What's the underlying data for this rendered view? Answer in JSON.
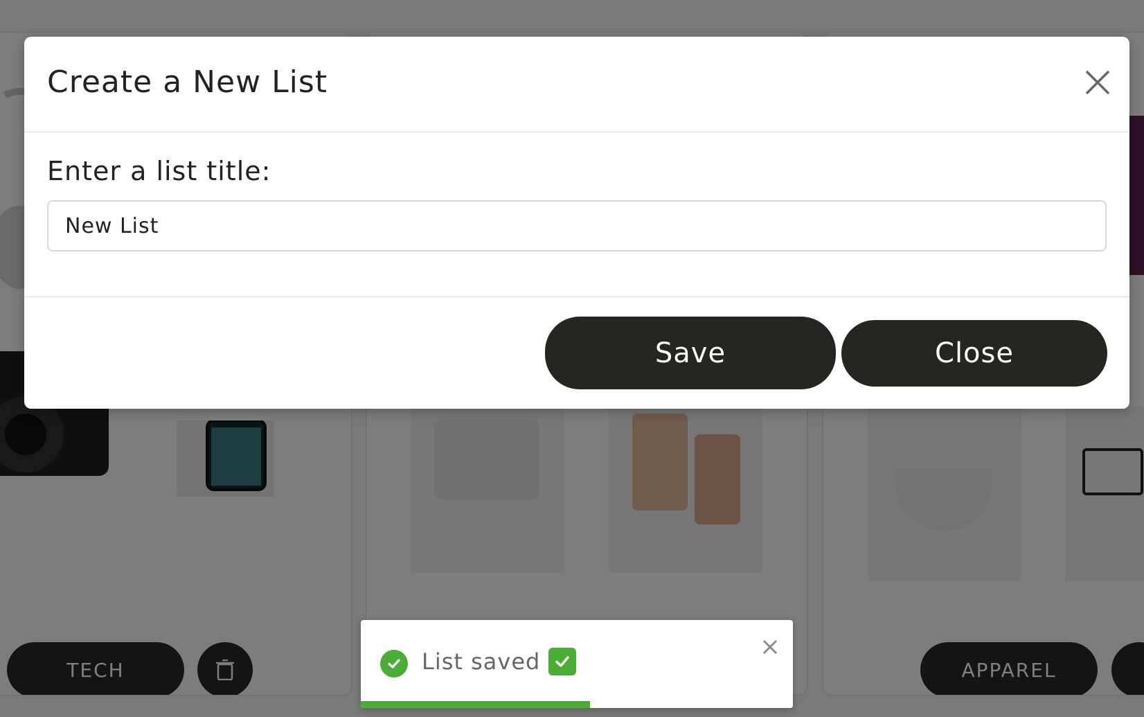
{
  "background": {
    "cards": [
      {
        "pill_label": "TECH"
      },
      {
        "pill_label": ""
      },
      {
        "pill_label": "APPAREL"
      }
    ]
  },
  "modal": {
    "title": "Create a New List",
    "field_label": "Enter a list title:",
    "input_value": "New List",
    "save_label": "Save",
    "close_label": "Close"
  },
  "toast": {
    "message": "List saved",
    "icon": "check-circle-icon",
    "progress": 0.53,
    "accent_color": "#4aad34"
  },
  "colors": {
    "button_bg": "#262522",
    "overlay": "rgba(0,0,0,0.5)"
  }
}
